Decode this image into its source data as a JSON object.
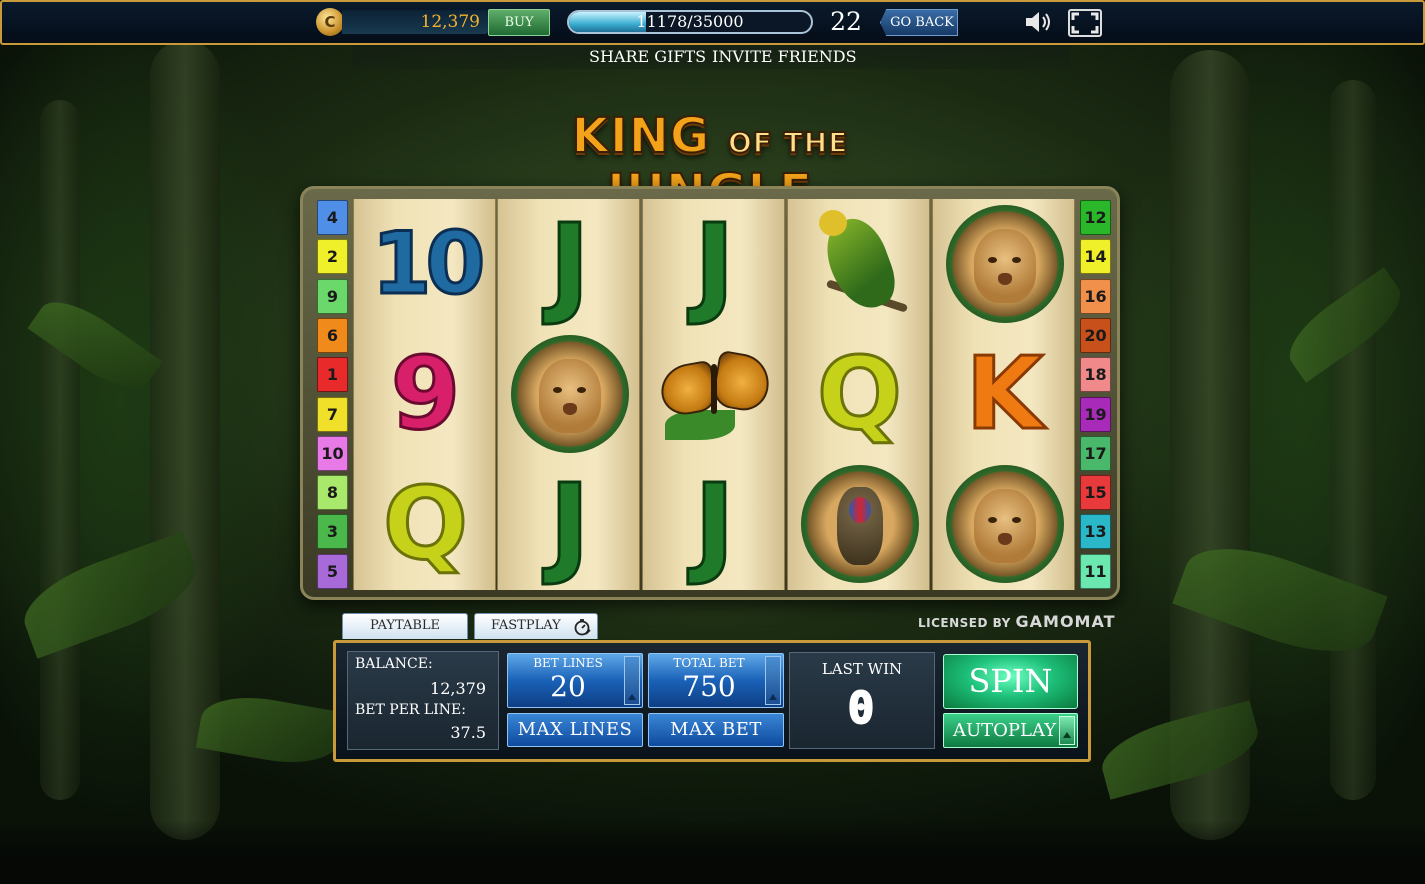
{
  "top_bar": {
    "coin_symbol": "C",
    "balance": "12,379",
    "buy_label": "BUY",
    "xp_text": "11178/35000",
    "xp_progress": 0.319,
    "level": "22",
    "go_back_label": "GO BACK",
    "speaker_icon": "speaker-icon",
    "fullscreen_icon": "fullscreen-icon"
  },
  "share_bar": {
    "share_gifts_label": "SHARE GIFTS",
    "invite_friends_label": "INVITE FRIENDS"
  },
  "logo": {
    "part1": "KING",
    "part2": "OF THE",
    "part3": "JUNGLE"
  },
  "reels": [
    [
      "10",
      "9",
      "Q"
    ],
    [
      "J",
      "lion",
      "J"
    ],
    [
      "J",
      "butterfly",
      "J"
    ],
    [
      "parrot",
      "Q",
      "mandrill"
    ],
    [
      "lion",
      "K",
      "lion"
    ]
  ],
  "paylines_left": [
    {
      "num": "4",
      "color": "#4f8fe8"
    },
    {
      "num": "2",
      "color": "#f0f02a"
    },
    {
      "num": "9",
      "color": "#6ad86a"
    },
    {
      "num": "6",
      "color": "#f08a1a"
    },
    {
      "num": "1",
      "color": "#e82a2a"
    },
    {
      "num": "7",
      "color": "#f0e02a"
    },
    {
      "num": "10",
      "color": "#e87ae8"
    },
    {
      "num": "8",
      "color": "#a8e86a"
    },
    {
      "num": "3",
      "color": "#4ab84a"
    },
    {
      "num": "5",
      "color": "#a86ad8"
    }
  ],
  "paylines_right": [
    {
      "num": "12",
      "color": "#2ab82a"
    },
    {
      "num": "14",
      "color": "#f0f02a"
    },
    {
      "num": "16",
      "color": "#f0904a"
    },
    {
      "num": "20",
      "color": "#c8501a"
    },
    {
      "num": "18",
      "color": "#f08a8a"
    },
    {
      "num": "19",
      "color": "#a82ab8"
    },
    {
      "num": "17",
      "color": "#4ab86a"
    },
    {
      "num": "15",
      "color": "#e83a3a"
    },
    {
      "num": "13",
      "color": "#2ab8c8"
    },
    {
      "num": "11",
      "color": "#6ae8b0"
    }
  ],
  "licensed": {
    "prefix": "LICENSED BY",
    "brand": "GAMOMAT"
  },
  "tabs": {
    "paytable_label": "PAYTABLE",
    "fastplay_label": "FASTPLAY"
  },
  "panel": {
    "balance_label": "BALANCE:",
    "balance_value": "12,379",
    "bet_per_line_label": "BET PER LINE:",
    "bet_per_line_value": "37.5",
    "bet_lines_label": "BET LINES",
    "bet_lines_value": "20",
    "total_bet_label": "TOTAL BET",
    "total_bet_value": "750",
    "max_lines_label": "MAX LINES",
    "max_bet_label": "MAX BET",
    "last_win_label": "LAST WIN",
    "last_win_value": "0",
    "spin_label": "SPIN",
    "autoplay_label": "AUTOPLAY"
  }
}
